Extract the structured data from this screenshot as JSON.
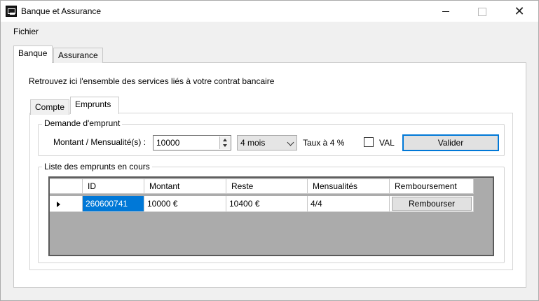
{
  "window": {
    "title": "Banque et Assurance",
    "close_glyph": "✕"
  },
  "menu": {
    "fichier": "Fichier"
  },
  "tabs": [
    {
      "label": "Banque"
    },
    {
      "label": "Assurance"
    }
  ],
  "banque": {
    "intro": "Retrouvez ici l'ensemble des services liés à votre contrat bancaire",
    "subtabs": [
      {
        "label": "Compte"
      },
      {
        "label": "Emprunts"
      }
    ],
    "demande": {
      "title": "Demande d'emprunt",
      "montant_label": "Montant / Mensualité(s) :",
      "montant_value": "10000",
      "duree_value": "4 mois",
      "taux": "Taux à 4 %",
      "val_label": "VAL",
      "valider_label": "Valider"
    },
    "liste": {
      "title": "Liste des emprunts en cours",
      "columns": [
        "ID",
        "Montant",
        "Reste",
        "Mensualités",
        "Remboursement"
      ],
      "rows": [
        {
          "id": "260600741",
          "montant": "10000 €",
          "reste": "10400 €",
          "mensualites": "4/4",
          "action": "Rembourser"
        }
      ]
    }
  }
}
